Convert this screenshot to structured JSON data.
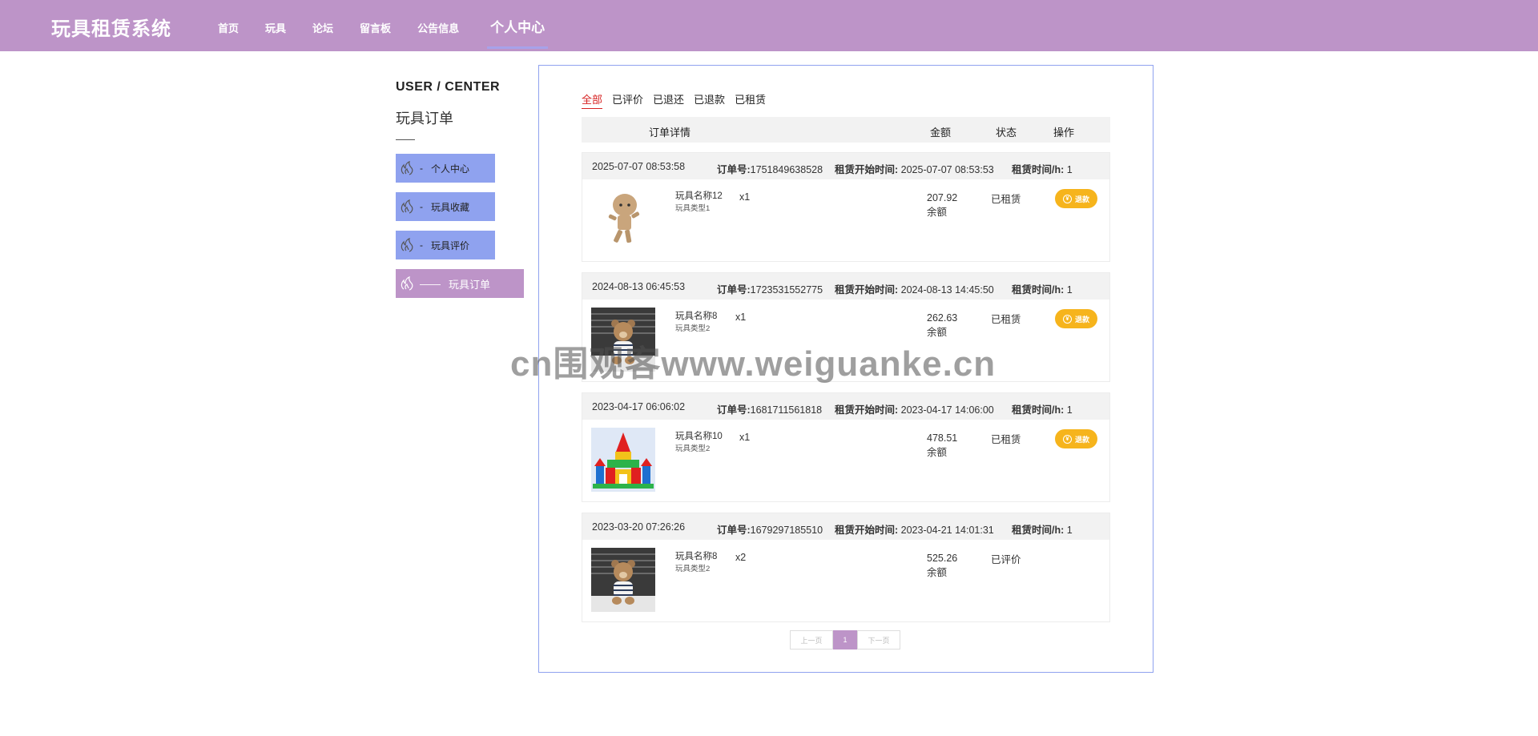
{
  "brand": "玩具租赁系统",
  "nav": [
    "首页",
    "玩具",
    "论坛",
    "留言板",
    "公告信息",
    "个人中心"
  ],
  "sidebar": {
    "title_en": "USER / CENTER",
    "title_cn": "玩具订单",
    "items": [
      {
        "label": "个人中心",
        "dash": "-"
      },
      {
        "label": "玩具收藏",
        "dash": "-"
      },
      {
        "label": "玩具评价",
        "dash": "-"
      },
      {
        "label": "玩具订单",
        "dash": "——"
      }
    ]
  },
  "tabs": [
    "全部",
    "已评价",
    "已退还",
    "已退款",
    "已租赁"
  ],
  "table_head": {
    "detail": "订单详情",
    "amount": "金额",
    "status": "状态",
    "action": "操作"
  },
  "labels": {
    "order_no": "订单号:",
    "start_time": "租赁开始时间:",
    "duration": "租赁时间/h:",
    "currency": "余额",
    "refund": "退款",
    "refund_coin": "¥"
  },
  "orders": [
    {
      "created": "2025-07-07 08:53:58",
      "order_no": "1751849638528",
      "start": "2025-07-07 08:53:53",
      "hours": "1",
      "name": "玩具名称12",
      "type": "玩具类型1",
      "qty": "x1",
      "amount": "207.92",
      "status": "已租赁",
      "refund": true,
      "image": "wooden-robot"
    },
    {
      "created": "2024-08-13 06:45:53",
      "order_no": "1723531552775",
      "start": "2024-08-13 14:45:50",
      "hours": "1",
      "name": "玩具名称8",
      "type": "玩具类型2",
      "qty": "x1",
      "amount": "262.63",
      "status": "已租赁",
      "refund": true,
      "image": "teddy-bear"
    },
    {
      "created": "2023-04-17 06:06:02",
      "order_no": "1681711561818",
      "start": "2023-04-17 14:06:00",
      "hours": "1",
      "name": "玩具名称10",
      "type": "玩具类型2",
      "qty": "x1",
      "amount": "478.51",
      "status": "已租赁",
      "refund": true,
      "image": "block-castle"
    },
    {
      "created": "2023-03-20 07:26:26",
      "order_no": "1679297185510",
      "start": "2023-04-21 14:01:31",
      "hours": "1",
      "name": "玩具名称8",
      "type": "玩具类型2",
      "qty": "x2",
      "amount": "525.26",
      "status": "已评价",
      "refund": false,
      "image": "teddy-bear"
    }
  ],
  "pager": {
    "prev": "上一页",
    "current": "1",
    "next": "下一页"
  },
  "watermark": "cn围观客www.weiguanke.cn",
  "colors": {
    "primary": "#bd94c8",
    "sidebar": "#8fa2ef",
    "refund": "#f6b41c",
    "active_tab": "#d62222"
  }
}
